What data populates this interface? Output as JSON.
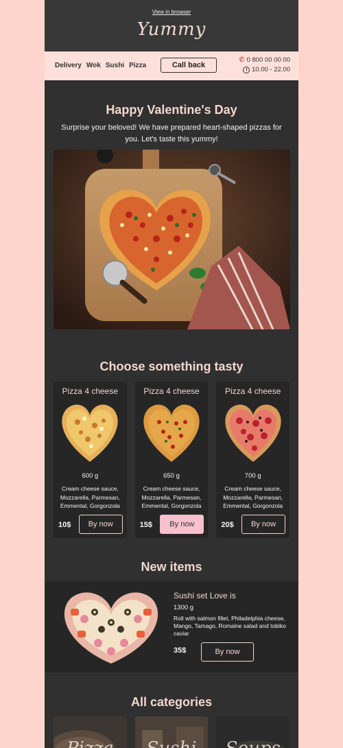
{
  "header": {
    "view_in_browser": "View in browser",
    "logo": "Yummy"
  },
  "nav": {
    "links": [
      "Delivery",
      "Wok",
      "Sushi",
      "Pizza"
    ],
    "call_back": "Call back",
    "phone": "0 800 00 00 00",
    "hours": "10.00 - 22.00",
    "phone_icon": "phone-icon",
    "clock_icon": "clock-icon"
  },
  "hero": {
    "title": "Happy Valentine's Day",
    "text": "Surprise your beloved! We have prepared heart-shaped pizzas for you. Let's taste this yummy!"
  },
  "products": {
    "title": "Choose something tasty",
    "items": [
      {
        "name": "Pizza 4 cheese",
        "weight": "600 g",
        "desc": "Cream cheese sauce, Mozzarella, Parmesan, Emmental, Gorgonzola",
        "price": "10$",
        "buy": "By now"
      },
      {
        "name": "Pizza 4 cheese",
        "weight": "650 g",
        "desc": "Cream cheese sauce, Mozzarella, Parmesan, Emmental, Gorgonzola",
        "price": "15$",
        "buy": "By now"
      },
      {
        "name": "Pizza 4 cheese",
        "weight": "700 g",
        "desc": "Cream cheese sauce, Mozzarella, Parmesan, Emmental, Gorgonzola",
        "price": "20$",
        "buy": "By now"
      }
    ]
  },
  "new_items": {
    "title": "New items",
    "name": "Sushi set Love is",
    "weight": "1300 g",
    "desc": "Roll with salmon fillet, Philadelphia cheese, Mango, Tamago, Romaine salad and tobiko caviar",
    "price": "35$",
    "buy": "By now"
  },
  "categories": {
    "title": "All categories",
    "items": [
      {
        "label": "Pizza"
      },
      {
        "label": "Sushi"
      },
      {
        "label": "Soups"
      }
    ]
  },
  "colors": {
    "accent": "#f3d7d0",
    "background": "#fdd5cd",
    "panel": "#303030",
    "button_fill": "#f7c0cf"
  }
}
